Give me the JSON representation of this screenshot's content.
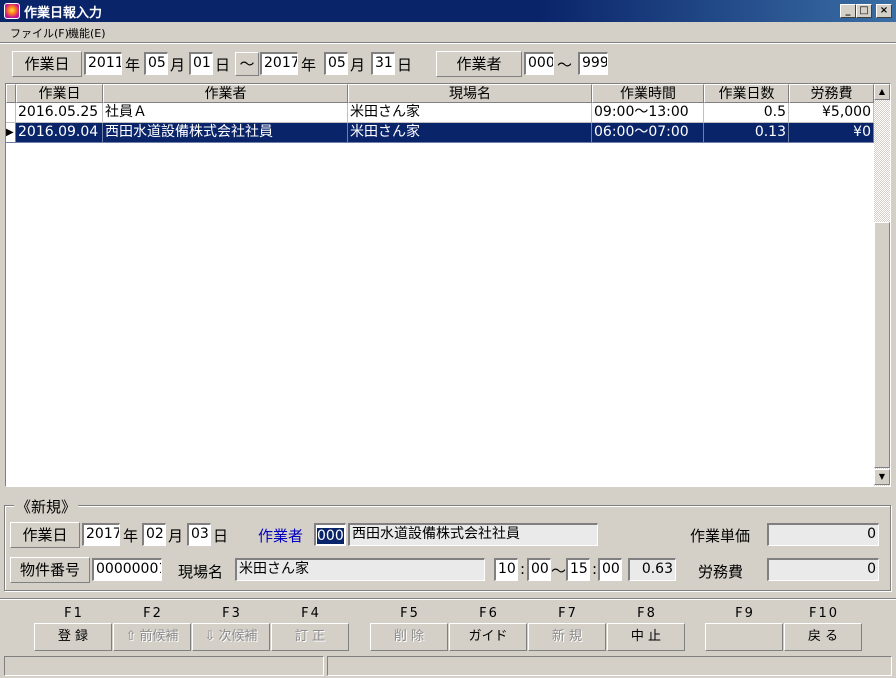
{
  "window": {
    "title": "作業日報入力"
  },
  "menu": {
    "items": [
      "ファイル(F)",
      "機能(E)"
    ]
  },
  "filter": {
    "date_label": "作業日",
    "from_year": "2011",
    "from_month": "05",
    "from_day": "01",
    "tilde": "～",
    "to_year": "2017",
    "to_month": "05",
    "to_day": "31",
    "year_unit": "年",
    "month_unit": "月",
    "day_unit": "日",
    "worker_label": "作業者",
    "worker_from": "000",
    "worker_to": "999"
  },
  "grid": {
    "columns": [
      "作業日",
      "作業者",
      "現場名",
      "作業時間",
      "作業日数",
      "労務費"
    ],
    "rows": [
      {
        "date": "2016.05.25",
        "worker": "社員Ａ",
        "site": "米田さん家",
        "time": "09:00～13:00",
        "days": "0.5",
        "cost": "¥5,000",
        "selected": false
      },
      {
        "date": "2016.09.04",
        "worker": "西田水道設備株式会社社員",
        "site": "米田さん家",
        "time": "06:00～07:00",
        "days": "0.13",
        "cost": "¥0",
        "selected": true
      }
    ]
  },
  "form": {
    "section_title": "《新規》",
    "date_label": "作業日",
    "year": "2017",
    "month": "02",
    "day": "03",
    "year_unit": "年",
    "month_unit": "月",
    "day_unit": "日",
    "worker_label": "作業者",
    "worker_code": "000",
    "worker_name": "西田水道設備株式会社社員",
    "unit_price_label": "作業単価",
    "unit_price": "0",
    "property_label": "物件番号",
    "property_no": "00000001",
    "site_label": "現場名",
    "site_name": "米田さん家",
    "start_h": "10",
    "start_m": "00",
    "end_h": "15",
    "end_m": "00",
    "colon": ":",
    "tilde": "～",
    "days": "0.63",
    "cost_label": "労務費",
    "cost": "0"
  },
  "fkeys": [
    {
      "key": "F1",
      "label": "登 録",
      "enabled": true
    },
    {
      "key": "F2",
      "label": "前候補",
      "enabled": false,
      "icon": "up-arrow-icon"
    },
    {
      "key": "F3",
      "label": "次候補",
      "enabled": false,
      "icon": "down-arrow-icon"
    },
    {
      "key": "F4",
      "label": "訂 正",
      "enabled": false
    },
    {
      "key": "F5",
      "label": "削 除",
      "enabled": false
    },
    {
      "key": "F6",
      "label": "ガイド",
      "enabled": true
    },
    {
      "key": "F7",
      "label": "新 規",
      "enabled": false
    },
    {
      "key": "F8",
      "label": "中 止",
      "enabled": true
    },
    {
      "key": "F9",
      "label": "",
      "enabled": true
    },
    {
      "key": "F10",
      "label": "戻 る",
      "enabled": true
    }
  ],
  "colors": {
    "titlebar": "#0a246a",
    "selection": "#0a246a",
    "face": "#d4d0c8",
    "worker_label": "#0000c0"
  }
}
